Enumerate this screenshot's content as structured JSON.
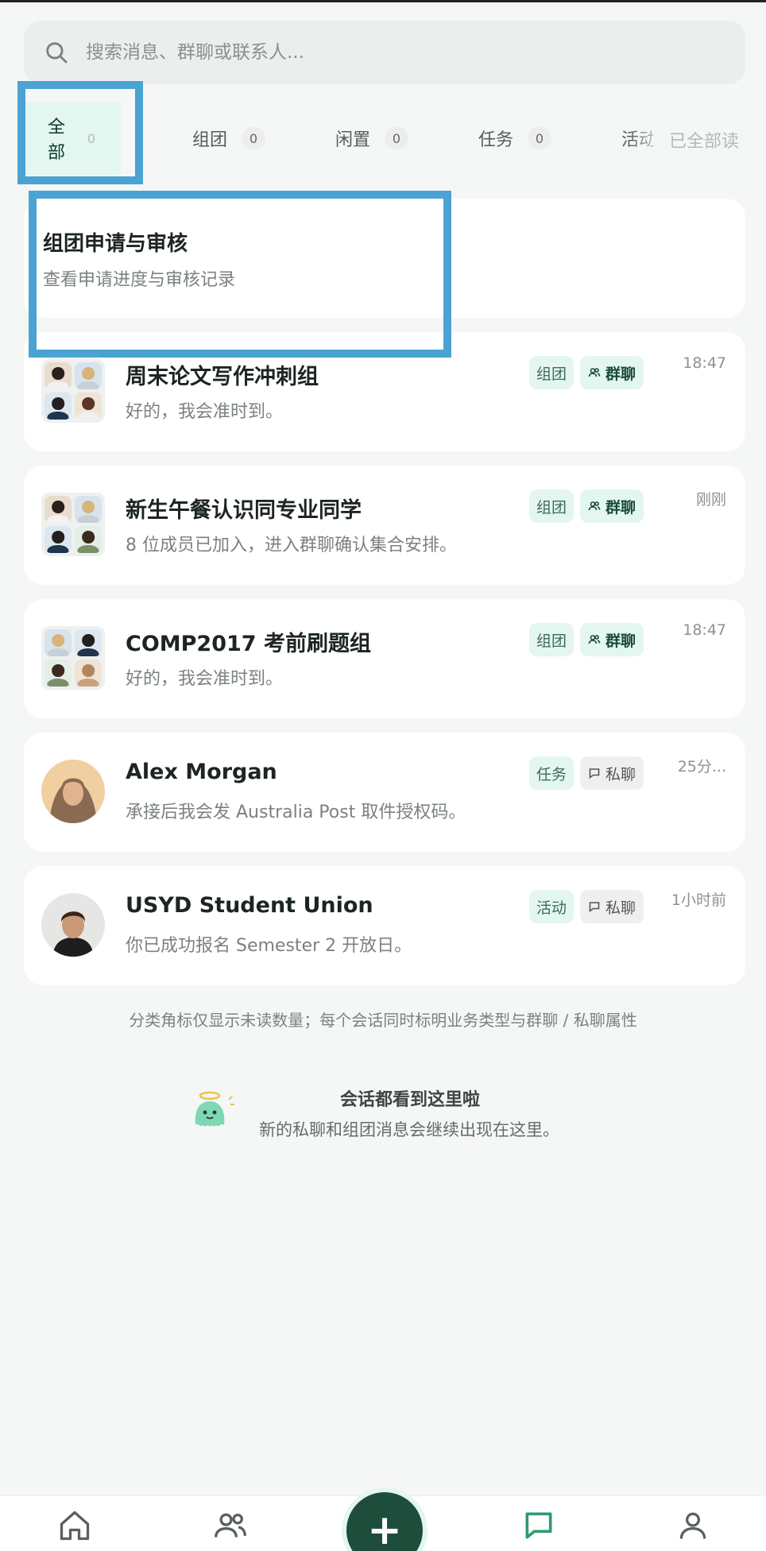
{
  "search": {
    "placeholder": "搜索消息、群聊或联系人..."
  },
  "tabs": [
    {
      "label": "全部",
      "count": "0",
      "active": true
    },
    {
      "label": "组团",
      "count": "0"
    },
    {
      "label": "闲置",
      "count": "0"
    },
    {
      "label": "任务",
      "count": "0"
    },
    {
      "label": "活动"
    }
  ],
  "mark_all_read": "已全部读",
  "review_card": {
    "title": "组团申请与审核",
    "subtitle": "查看申请进度与审核记录"
  },
  "conversations": [
    {
      "name": "周末论文写作冲刺组",
      "preview": "好的，我会准时到。",
      "business_tag": "组团",
      "kind_tag": "群聊",
      "time": "18:47",
      "avatar": "group-avatar"
    },
    {
      "name": "新生午餐认识同专业同学",
      "preview": "8 位成员已加入，进入群聊确认集合安排。",
      "business_tag": "组团",
      "kind_tag": "群聊",
      "time": "刚刚",
      "avatar": "group-avatar"
    },
    {
      "name": "COMP2017 考前刷题组",
      "preview": "好的，我会准时到。",
      "business_tag": "组团",
      "kind_tag": "群聊",
      "time": "18:47",
      "avatar": "group-avatar"
    },
    {
      "name": "Alex Morgan",
      "preview": "承接后我会发 Australia Post 取件授权码。",
      "business_tag": "任务",
      "kind_tag": "私聊",
      "time": "25分...",
      "avatar": "person-avatar"
    },
    {
      "name": "USYD Student Union",
      "preview": "你已成功报名 Semester 2 开放日。",
      "business_tag": "活动",
      "kind_tag": "私聊",
      "time": "1小时前",
      "avatar": "person-avatar"
    }
  ],
  "footnote": "分类角标仅显示未读数量；每个会话同时标明业务类型与群聊 / 私聊属性",
  "end_state": {
    "title": "会话都看到这里啦",
    "subtitle": "新的私聊和组团消息会继续出现在这里。"
  },
  "bottom_nav": {
    "items": [
      "home-icon",
      "people-icon",
      "add-button",
      "chat-icon",
      "profile-icon"
    ],
    "active": "chat-icon",
    "fab_symbol": "+"
  },
  "colors": {
    "accent": "#1e4d3c",
    "accent_light": "#e3f6ef",
    "highlight": "#4aa3d3",
    "background": "#f5f7f6"
  }
}
